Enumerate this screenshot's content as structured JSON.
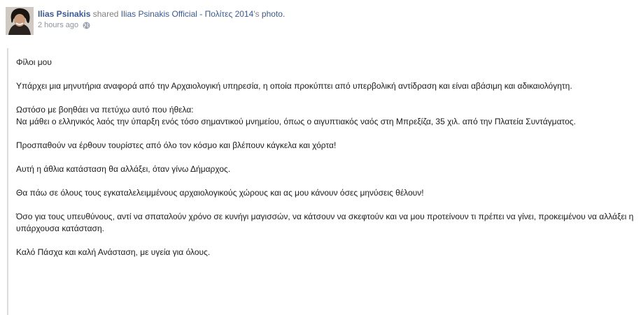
{
  "post": {
    "author": "Ilias Psinakis",
    "shared_text": "shared",
    "source_page": "Ilias Psinakis Official - Πολίτες 2014",
    "source_suffix": "'s",
    "photo_link": "photo.",
    "timestamp": "2 hours ago",
    "privacy_icon": "globe-icon",
    "paragraphs": [
      "Φίλοι μου",
      "Υπάρχει μια μηνυτήρια αναφορά από την Αρχαιολογική υπηρεσία, η οποία προκύπτει από υπερβολική αντίδραση και είναι αβάσιμη και αδικαιολόγητη.",
      "Ωστόσο με βοηθάει να πετύχω αυτό που ήθελα:",
      "Να μάθει ο ελληνικός λαός την ύπαρξη ενός τόσο σημαντικού μνημείου, όπως ο αιγυπτιακός ναός στη Μπρεξίζα, 35 χιλ. από την Πλατεία Συντάγματος.",
      "Προσπαθούν να έρθουν τουρίστες από όλο τον κόσμο και βλέπουν κάγκελα και χόρτα!",
      "Αυτή η άθλια κατάσταση θα αλλάξει, όταν γίνω Δήμαρχος.",
      "Θα πάω σε όλους τους εγκαταλελειμμένους αρχαιολογικούς χώρους και ας μου κάνουν όσες μηνύσεις θέλουν!",
      "Όσο για τους υπευθύνους, αντί να σπαταλούν χρόνο σε κυνήγι μαγισσών, να κάτσουν να σκεφτούν και να μου προτείνουν τι πρέπει να γίνει, προκειμένου να αλλάξει η υπάρχουσα κατάσταση.",
      "Καλό Πάσχα και καλή Ανάσταση, με υγεία για όλους."
    ]
  },
  "colors": {
    "link": "#3b5998",
    "meta": "#90949c",
    "quote_bar": "#d8dbe1",
    "text": "#1a1a1a"
  }
}
